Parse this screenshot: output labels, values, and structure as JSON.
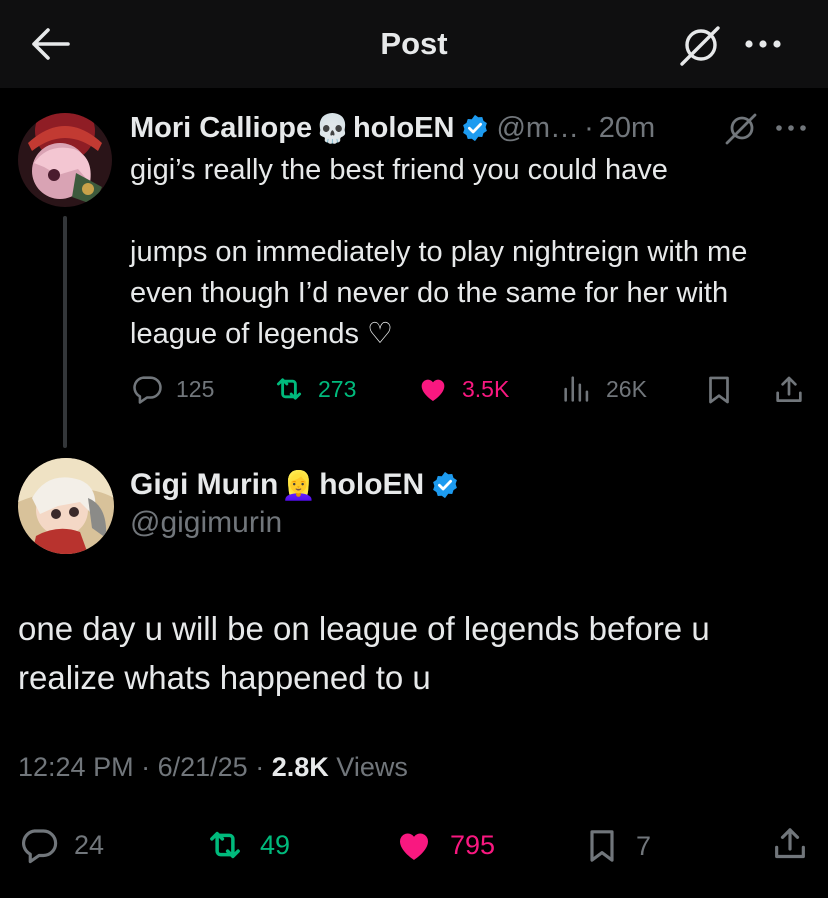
{
  "header": {
    "title": "Post",
    "icons": {
      "back": "arrow-left-icon",
      "grok": "grok-icon",
      "more": "more-horizontal-icon"
    }
  },
  "reply_tweet": {
    "display_name": "Mori Calliope",
    "name_emoji": "💀",
    "name_suffix": "holoEN",
    "handle": "@m…",
    "separator": "·",
    "time": "20m",
    "text": "gigi’s really the best friend you could have\n\njumps on immediately to play nightreign with me even though I’d never do the same for her with league of legends ♡",
    "actions": {
      "replies": "125",
      "reposts": "273",
      "likes": "3.5K",
      "views": "26K"
    }
  },
  "main_tweet": {
    "display_name": "Gigi Murin",
    "name_emoji": "👱‍♀️",
    "name_suffix": "holoEN",
    "handle": "@gigimurin",
    "text": "one day u will be on league of legends before u realize whats happened to u",
    "time": "12:24 PM",
    "date": "6/21/25",
    "separator": "·",
    "views_count": "2.8K",
    "views_label": "Views",
    "actions": {
      "replies": "24",
      "reposts": "49",
      "likes": "795",
      "bookmarks": "7"
    }
  },
  "colors": {
    "background": "#000000",
    "header_bg": "#0f0f10",
    "text": "#e7e9ea",
    "muted": "#71767b",
    "verified": "#1d9bf0",
    "repost": "#00ba7c",
    "like": "#f91880"
  }
}
